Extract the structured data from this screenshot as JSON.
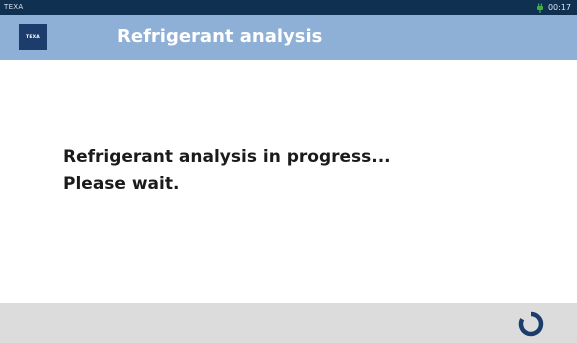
{
  "status_bar": {
    "brand": "TEXA",
    "time": "00:17",
    "plug_icon": "plug-icon"
  },
  "header": {
    "logo_text": "TEXA",
    "title": "Refrigerant analysis"
  },
  "main": {
    "line1": "Refrigerant analysis in progress...",
    "line2": "Please wait."
  },
  "footer": {
    "spinner_icon": "loading-spinner-icon"
  },
  "colors": {
    "status_bar": "#103052",
    "header": "#8fb0d6",
    "logo": "#1c3d6b",
    "footer": "#dcdcdc",
    "spinner": "#1c3d6b",
    "plug_icon": "#3fae49"
  }
}
